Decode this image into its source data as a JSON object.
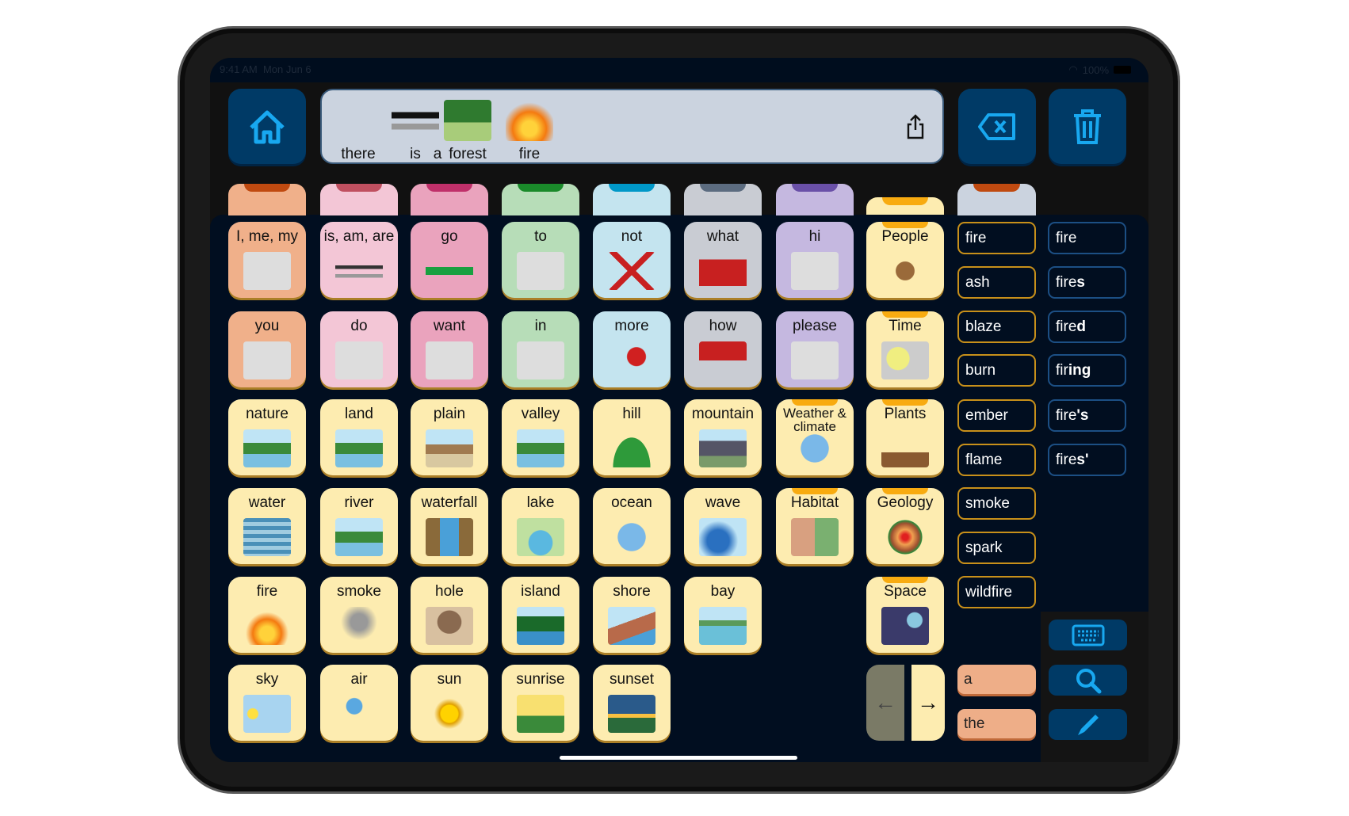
{
  "status_bar": {
    "time": "9:41 AM",
    "date": "Mon Jun 6",
    "battery": "100%"
  },
  "sentence": {
    "words": [
      {
        "text": "there",
        "pic": "linear-gradient(#cbd3df,#cbd3df)",
        "icon": "person-pointing-signpost"
      },
      {
        "text": "is",
        "pic": "linear-gradient(#cbd3df 30%,#111 30% 45%,#cbd3df 45% 58%,#999 58% 72%,#cbd3df 72%)",
        "icon": "equals"
      },
      {
        "text": "a",
        "pic": "",
        "icon": ""
      },
      {
        "text": "forest",
        "pic": "linear-gradient(#2f7a2f 55%,#a8cc7a 55%)",
        "icon": "forest"
      },
      {
        "text": "fire",
        "pic": "radial-gradient(circle at 50% 70%,#ffd23a 20%,#f47a10 45%,#cbd3df 70%)",
        "icon": "fire"
      }
    ]
  },
  "header": {
    "home": "home-icon",
    "share": "share-icon",
    "backspace": "backspace-icon",
    "clear": "trash-icon"
  },
  "tabs": [
    {
      "bg": "#f0b08a",
      "strip": "#c04a10"
    },
    {
      "bg": "#f3c6d6",
      "strip": "#c05060"
    },
    {
      "bg": "#eaa3bd",
      "strip": "#c0306a"
    },
    {
      "bg": "#b7ddb8",
      "strip": "#1a8a2a"
    },
    {
      "bg": "#c4e4ef",
      "strip": "#0098c8"
    },
    {
      "bg": "#c9ccd3",
      "strip": "#5c6c80"
    },
    {
      "bg": "#c5b8e0",
      "strip": "#6a50a8"
    }
  ],
  "grid": [
    [
      {
        "label": "I, me, my",
        "bg": "#f0b08a",
        "pic": "person"
      },
      {
        "label": "is, am, are",
        "bg": "#f3c6d6",
        "pic": "equals"
      },
      {
        "label": "go",
        "bg": "#eaa3bd",
        "pic": "green-arrow"
      },
      {
        "label": "to",
        "bg": "#b7ddb8",
        "pic": "arrow-to-line"
      },
      {
        "label": "not",
        "bg": "#c4e4ef",
        "pic": "red-x"
      },
      {
        "label": "what",
        "bg": "#c9ccd3",
        "pic": "question-square"
      },
      {
        "label": "hi",
        "bg": "#c5b8e0",
        "pic": "waving-person"
      },
      {
        "label": "People",
        "bg": "#fdecb0",
        "pic": "faces",
        "folder": true
      }
    ],
    [
      {
        "label": "you",
        "bg": "#f0b08a",
        "pic": "two-people"
      },
      {
        "label": "do",
        "bg": "#f3c6d6",
        "pic": "person-doing"
      },
      {
        "label": "want",
        "bg": "#eaa3bd",
        "pic": "person-want"
      },
      {
        "label": "in",
        "bg": "#b7ddb8",
        "pic": "arrow-in"
      },
      {
        "label": "more",
        "bg": "#c4e4ef",
        "pic": "red-blocks"
      },
      {
        "label": "how",
        "bg": "#c9ccd3",
        "pic": "question-triangle"
      },
      {
        "label": "please",
        "bg": "#c5b8e0",
        "pic": "person-please"
      },
      {
        "label": "Time",
        "bg": "#fdecb0",
        "pic": "clock-calendar",
        "folder": true
      }
    ],
    [
      {
        "label": "nature",
        "pic": "landscape"
      },
      {
        "label": "land",
        "pic": "landscape"
      },
      {
        "label": "plain",
        "pic": "plain"
      },
      {
        "label": "valley",
        "pic": "landscape"
      },
      {
        "label": "hill",
        "pic": "hill"
      },
      {
        "label": "mountain",
        "pic": "mountain"
      },
      {
        "label": "Weather & climate",
        "pic": "globe",
        "folder": true
      },
      {
        "label": "Plants",
        "pic": "plants",
        "folder": true
      }
    ],
    [
      {
        "label": "water",
        "pic": "water"
      },
      {
        "label": "river",
        "pic": "landscape"
      },
      {
        "label": "waterfall",
        "pic": "waterfall"
      },
      {
        "label": "lake",
        "pic": "lake"
      },
      {
        "label": "ocean",
        "pic": "globe"
      },
      {
        "label": "wave",
        "pic": "wave"
      },
      {
        "label": "Habitat",
        "pic": "habitat",
        "folder": true
      },
      {
        "label": "Geology",
        "pic": "earth-core",
        "folder": true
      }
    ],
    [
      {
        "label": "fire",
        "pic": "fire"
      },
      {
        "label": "smoke",
        "pic": "smoke"
      },
      {
        "label": "hole",
        "pic": "hole"
      },
      {
        "label": "island",
        "pic": "island"
      },
      {
        "label": "shore",
        "pic": "shore"
      },
      {
        "label": "bay",
        "pic": "bay"
      },
      null,
      {
        "label": "Space",
        "pic": "space",
        "folder": true
      }
    ],
    [
      {
        "label": "sky",
        "pic": "sky"
      },
      {
        "label": "air",
        "pic": "air"
      },
      {
        "label": "sun",
        "pic": "sun"
      },
      {
        "label": "sunrise",
        "pic": "sunrise"
      },
      {
        "label": "sunset",
        "pic": "sunset"
      }
    ]
  ],
  "core_words": [
    "fire",
    "ash",
    "blaze",
    "burn",
    "ember",
    "flame",
    "smoke",
    "spark",
    "wildfire"
  ],
  "morphology": [
    {
      "base": "fire",
      "suffix": ""
    },
    {
      "base": "fire",
      "suffix": "s"
    },
    {
      "base": "fire",
      "suffix": "d"
    },
    {
      "base": "fir",
      "suffix": "ing"
    },
    {
      "base": "fire",
      "suffix": "'s"
    },
    {
      "base": "fire",
      "suffix": "s'"
    }
  ],
  "articles": [
    "a",
    "the"
  ],
  "nav": {
    "back": "←",
    "forward": "→"
  },
  "tools": [
    "keyboard-icon",
    "search-icon",
    "pencil-icon"
  ],
  "colors": {
    "accent": "#18a8f0",
    "button": "#003a66",
    "tile": "#fdecb0",
    "folder_tab": "#f8ab10"
  }
}
